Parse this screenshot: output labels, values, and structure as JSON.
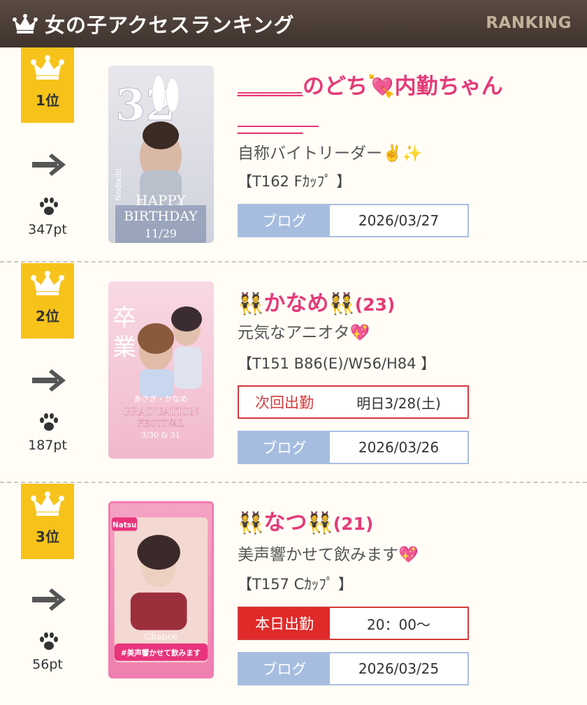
{
  "header": {
    "title": "女の子アクセスランキング",
    "en_label": "RANKING"
  },
  "entries": [
    {
      "rank": "1位",
      "points": "347pt",
      "name": "＿＿＿のどち💘内勤ちゃん",
      "name_suffix": "＿＿＿",
      "catch": "自称バイトリーダー✌️✨",
      "spec": "【T162 Fｶｯﾌﾟ 】",
      "blog_label": "ブログ",
      "blog_date": "2026/03/27",
      "photo": {
        "big_number": "32",
        "caption_1": "HAPPY",
        "caption_2": "BIRTHDAY",
        "date": "11/29",
        "signature": "Nodochi"
      }
    },
    {
      "rank": "2位",
      "points": "187pt",
      "name": "かなめ",
      "name_emoji": "👯",
      "age": "(23)",
      "catch": "元気なアニオタ💖",
      "spec": "【T151 B86(E)/W56/H84 】",
      "schedule_label": "次回出勤",
      "schedule_value": "明日3/28(土)",
      "blog_label": "ブログ",
      "blog_date": "2026/03/26",
      "photo": {
        "kanji_1": "卒",
        "kanji_2": "業",
        "names": "あさぎ・かなめ",
        "caption_1": "GRADUATION",
        "caption_2": "FESTIVAL",
        "dates": "3/30 & 31"
      }
    },
    {
      "rank": "3位",
      "points": "56pt",
      "name": "なつ",
      "name_emoji": "👯",
      "age": "(21)",
      "catch": "美声響かせて飲みます💖",
      "spec": "【T157 Cｶｯﾌﾟ 】",
      "schedule_label": "本日出勤",
      "schedule_value": "20：00〜",
      "blog_label": "ブログ",
      "blog_date": "2026/03/25",
      "photo": {
        "tag": "Natsu",
        "brand": "Chance",
        "banner": "#美声響かせて飲みます"
      }
    }
  ],
  "colors": {
    "header_bg": "#4a3d36",
    "gold": "#f7c31a",
    "pink": "#e53a78",
    "blue_label": "#a6bde0",
    "red": "#e02a2a"
  },
  "icons": [
    "crown-icon",
    "arrow-right-icon",
    "paw-icon"
  ]
}
